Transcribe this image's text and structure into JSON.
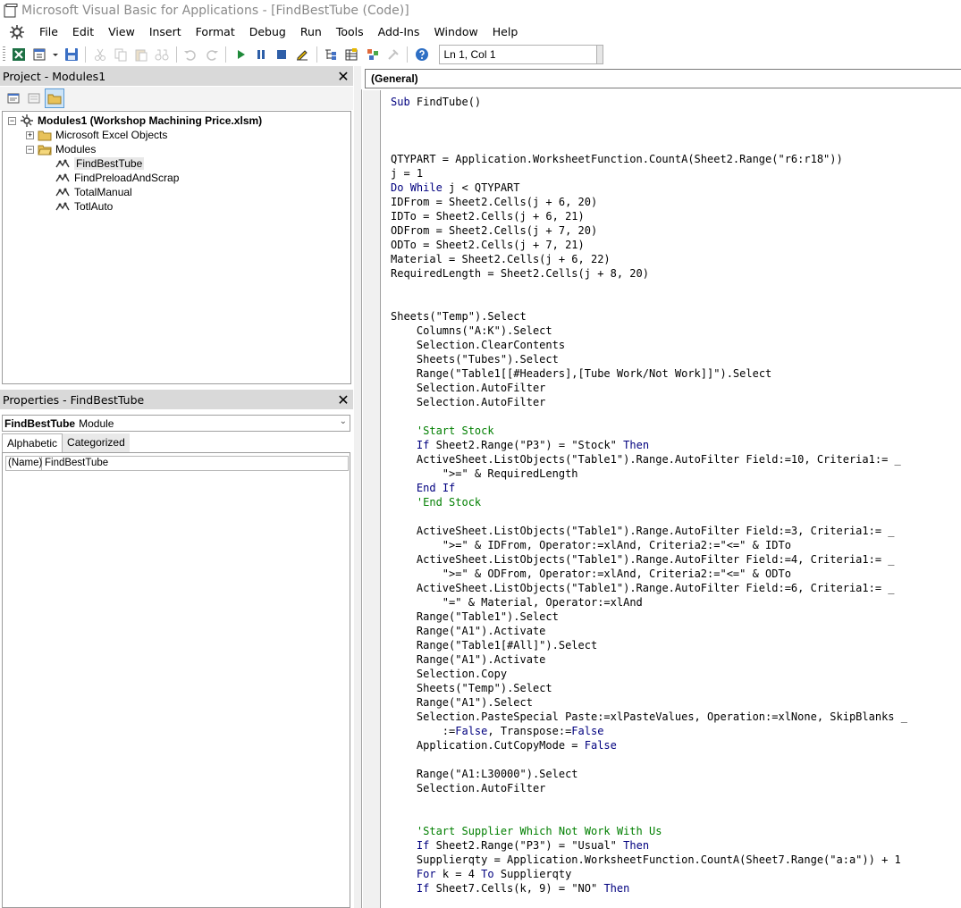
{
  "window": {
    "title": "Microsoft Visual Basic for Applications - [FindBestTube (Code)]"
  },
  "menu": [
    "File",
    "Edit",
    "View",
    "Insert",
    "Format",
    "Debug",
    "Run",
    "Tools",
    "Add-Ins",
    "Window",
    "Help"
  ],
  "toolbar": {
    "position_text": "Ln 1, Col 1"
  },
  "project": {
    "title": "Project - Modules1",
    "root": "Modules1 (Workshop Machining Price.xlsm)",
    "folders": [
      "Microsoft Excel Objects",
      "Modules"
    ],
    "modules": [
      "FindBestTube",
      "FindPreloadAndScrap",
      "TotalManual",
      "TotlAuto"
    ]
  },
  "properties": {
    "title": "Properties - FindBestTube",
    "object_name": "FindBestTube",
    "object_type": "Module",
    "tabs": [
      "Alphabetic",
      "Categorized"
    ],
    "rows": [
      {
        "name": "(Name)",
        "value": "FindBestTube"
      }
    ]
  },
  "code_window": {
    "object_combo": "(General)",
    "lines": [
      "Sub FindTube()",
      "",
      "",
      "",
      "QTYPART = Application.WorksheetFunction.CountA(Sheet2.Range(\"r6:r18\"))",
      "j = 1",
      "Do While j < QTYPART",
      "IDFrom = Sheet2.Cells(j + 6, 20)",
      "IDTo = Sheet2.Cells(j + 6, 21)",
      "ODFrom = Sheet2.Cells(j + 7, 20)",
      "ODTo = Sheet2.Cells(j + 7, 21)",
      "Material = Sheet2.Cells(j + 6, 22)",
      "RequiredLength = Sheet2.Cells(j + 8, 20)",
      "",
      "",
      "Sheets(\"Temp\").Select",
      "    Columns(\"A:K\").Select",
      "    Selection.ClearContents",
      "    Sheets(\"Tubes\").Select",
      "    Range(\"Table1[[#Headers],[Tube Work/Not Work]]\").Select",
      "    Selection.AutoFilter",
      "    Selection.AutoFilter",
      "",
      "    'Start Stock",
      "    If Sheet2.Range(\"P3\") = \"Stock\" Then",
      "    ActiveSheet.ListObjects(\"Table1\").Range.AutoFilter Field:=10, Criteria1:= _",
      "        \">=\" & RequiredLength",
      "    End If",
      "    'End Stock",
      "",
      "    ActiveSheet.ListObjects(\"Table1\").Range.AutoFilter Field:=3, Criteria1:= _",
      "        \">=\" & IDFrom, Operator:=xlAnd, Criteria2:=\"<=\" & IDTo",
      "    ActiveSheet.ListObjects(\"Table1\").Range.AutoFilter Field:=4, Criteria1:= _",
      "        \">=\" & ODFrom, Operator:=xlAnd, Criteria2:=\"<=\" & ODTo",
      "    ActiveSheet.ListObjects(\"Table1\").Range.AutoFilter Field:=6, Criteria1:= _",
      "        \"=\" & Material, Operator:=xlAnd",
      "    Range(\"Table1\").Select",
      "    Range(\"A1\").Activate",
      "    Range(\"Table1[#All]\").Select",
      "    Range(\"A1\").Activate",
      "    Selection.Copy",
      "    Sheets(\"Temp\").Select",
      "    Range(\"A1\").Select",
      "    Selection.PasteSpecial Paste:=xlPasteValues, Operation:=xlNone, SkipBlanks _",
      "        :=False, Transpose:=False",
      "    Application.CutCopyMode = False",
      "",
      "    Range(\"A1:L30000\").Select",
      "    Selection.AutoFilter",
      "",
      "",
      "    'Start Supplier Which Not Work With Us",
      "    If Sheet2.Range(\"P3\") = \"Usual\" Then",
      "    Supplierqty = Application.WorksheetFunction.CountA(Sheet7.Range(\"a:a\")) + 1",
      "    For k = 4 To Supplierqty",
      "    If Sheet7.Cells(k, 9) = \"NO\" Then"
    ]
  },
  "colors": {
    "keyword": "#00007f",
    "comment": "#007f00",
    "pane_title": "#d9d9d9"
  }
}
